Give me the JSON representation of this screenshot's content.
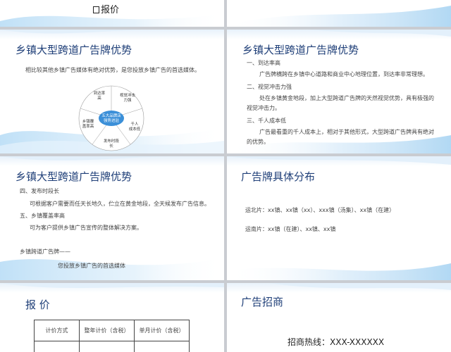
{
  "slides": {
    "s0": {
      "title": "报价"
    },
    "s2": {
      "title": "乡镇大型跨道广告牌优势",
      "intro": "相比较其他乡镇广告媒体有绝对优势，是您投放乡镇广告的首选媒体。",
      "center": [
        "五大品牌店",
        "强势进驻"
      ],
      "nodes": [
        {
          "lines": [
            "到达率",
            "高"
          ]
        },
        {
          "lines": [
            "视觉冲击",
            "力强"
          ]
        },
        {
          "lines": [
            "千人",
            "成本低"
          ]
        },
        {
          "lines": [
            "发布时段",
            "长"
          ]
        },
        {
          "lines": [
            "乡镇覆",
            "盖率高"
          ]
        }
      ]
    },
    "s3": {
      "title": "乡镇大型跨道广告牌优势",
      "lines": [
        "一、到达率高",
        "广告牌横跨在乡镇中心道路和商业中心地理位置，到达率非常理想。",
        "二、视觉冲击力强",
        "处在乡镇黄金地段，加上大型跨道广告牌的天然视觉优势，具有极强的",
        "视觉冲击力。",
        "三、千人成本低",
        "广告最看重的千人成本上，相对于其他形式，大型跨道广告牌具有绝对",
        "的优势。"
      ]
    },
    "s4": {
      "title": "乡镇大型跨道广告牌优势",
      "lines": [
        "四、发布时段长",
        "可根据客户需要而任天长地久，伫立在黄金地段，全天候发布广告信息。",
        "五、乡镇覆盖率高",
        "可为客户提供乡镇广告宣传的整体解决方案。",
        "乡镇跨道广告牌——",
        "您投放乡镇广告的首选媒体"
      ]
    },
    "s5": {
      "title": "广告牌具体分布",
      "lines": [
        "运北片：xx镇、xx镇（xx）、xxx镇（汤集）、xx镇（在建）",
        "运南片：xx镇（在建）、xx镇、xx镇"
      ]
    },
    "s6": {
      "title": "报    价",
      "headers": [
        "计价方式",
        "整年计价（含税）",
        "单月计价（含税）"
      ]
    },
    "s7": {
      "title": "广告招商",
      "hotline": "招商热线：XXX-XXXXXX"
    }
  },
  "colors": {
    "title": "#1f3f78",
    "wave": "#8ec5ec",
    "accent": "#3b8fd8"
  }
}
